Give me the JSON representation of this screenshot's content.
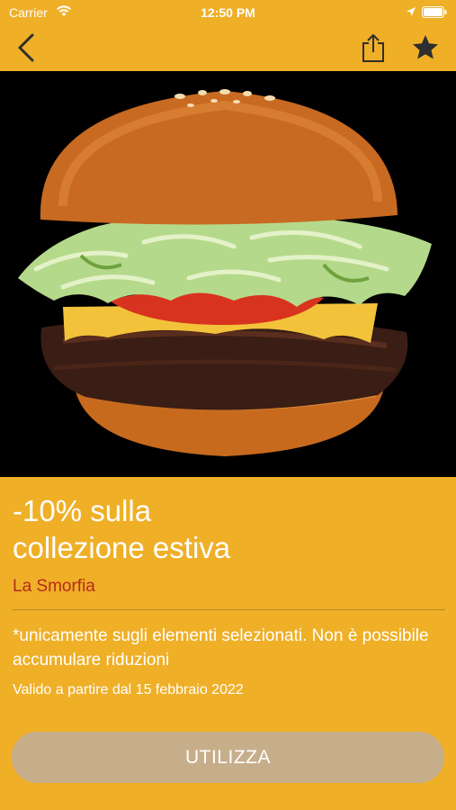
{
  "status_bar": {
    "carrier": "Carrier",
    "time": "12:50 PM"
  },
  "nav": {
    "back_icon": "chevron-left-icon",
    "share_icon": "share-icon",
    "favorite_icon": "star-icon"
  },
  "offer": {
    "title_line1": "-10% sulla",
    "title_line2": "collezione estiva",
    "merchant": "La Smorfia",
    "description": "*unicamente sugli elementi selezionati. Non è possibile accumulare riduzioni",
    "validity": "Valido a partire dal 15 febbraio 2022",
    "button_label": "UTILIZZA"
  },
  "colors": {
    "background": "#EFAF27",
    "merchant": "#B72B1E",
    "button": "#C7AE8B",
    "text": "#FFFFFF"
  }
}
